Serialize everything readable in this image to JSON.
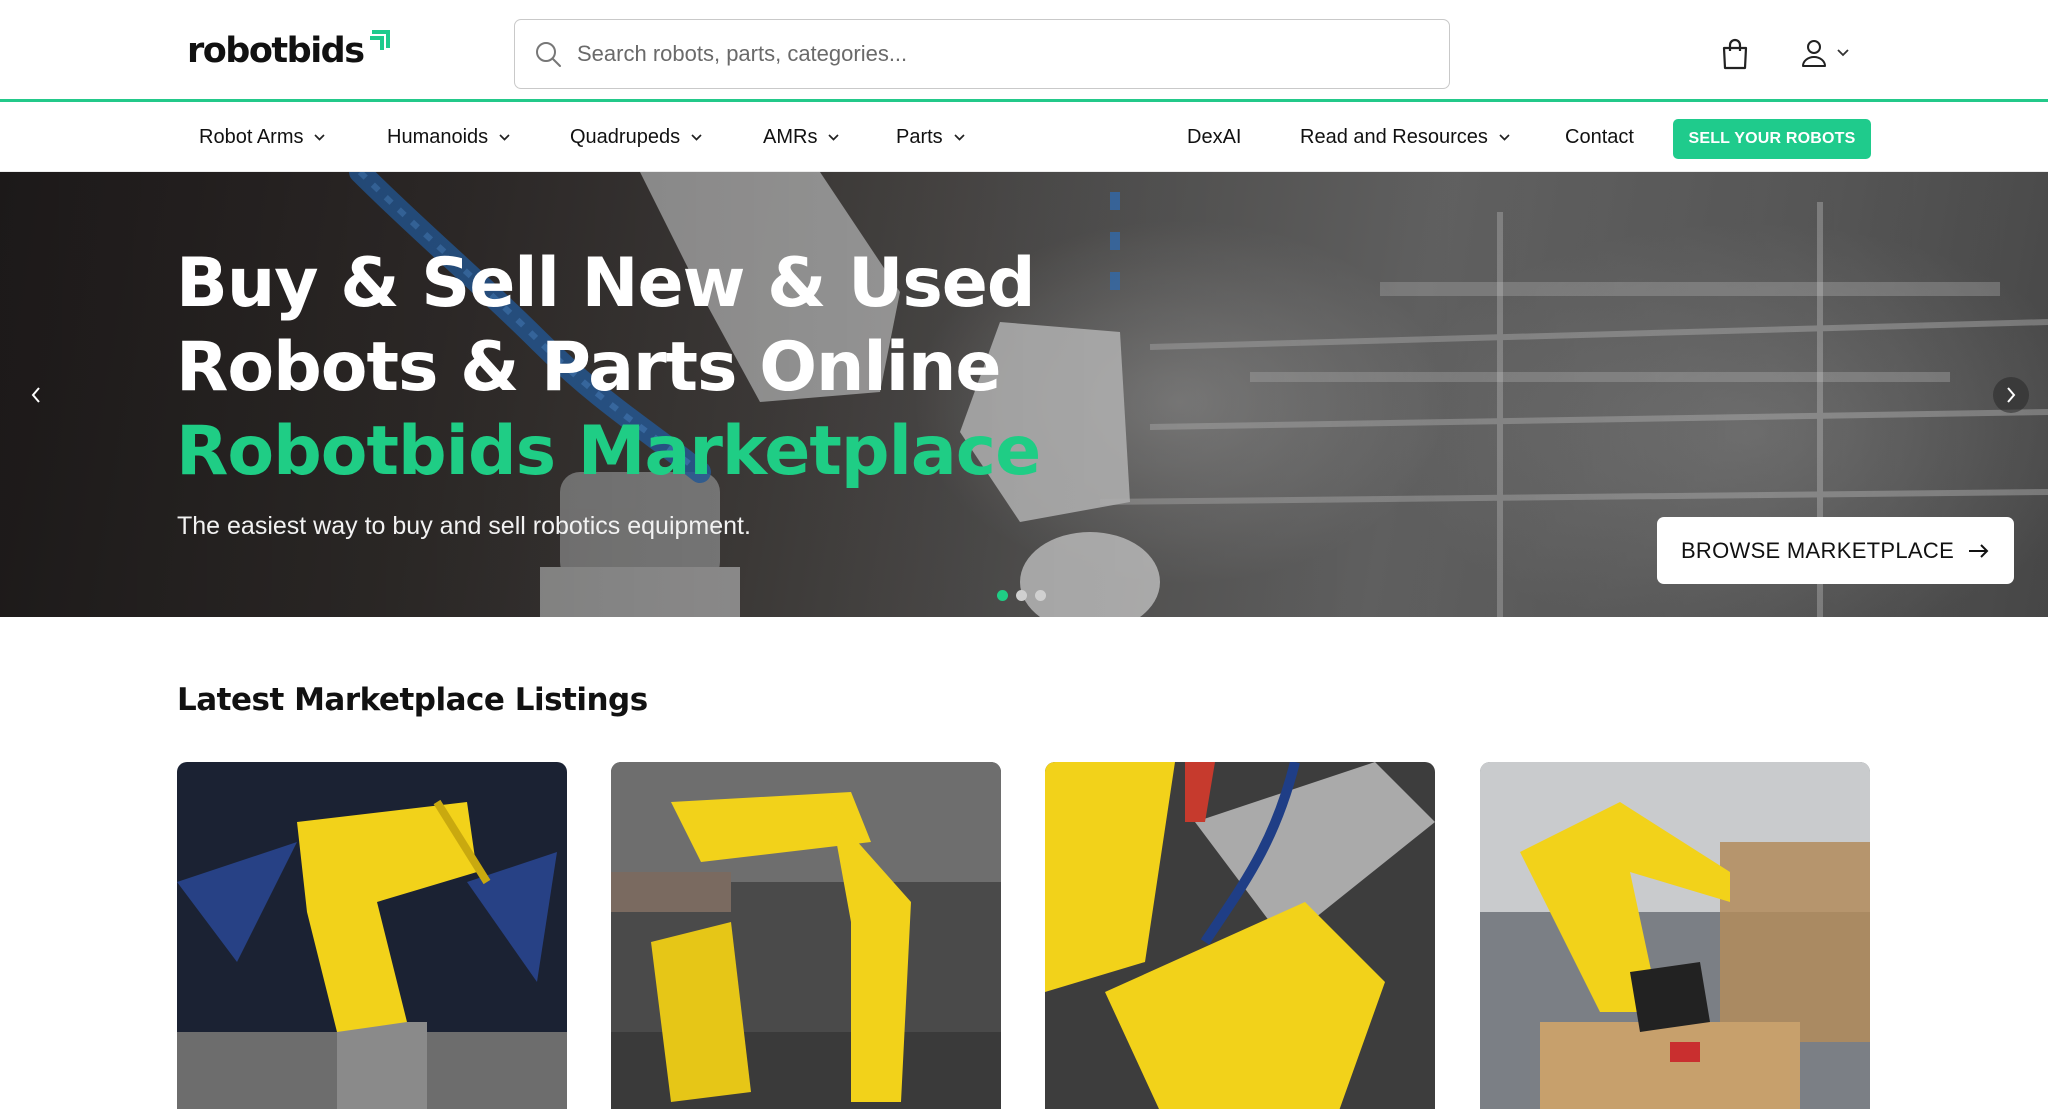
{
  "header": {
    "logo_text": "robotbids",
    "search": {
      "placeholder": "Search robots, parts, categories..."
    },
    "icons": {
      "search": "search-icon",
      "cart": "shopping-bag-icon",
      "account": "user-icon"
    }
  },
  "nav": {
    "items": [
      {
        "label": "Robot Arms",
        "has_dropdown": true
      },
      {
        "label": "Humanoids",
        "has_dropdown": true
      },
      {
        "label": "Quadrupeds",
        "has_dropdown": true
      },
      {
        "label": "AMRs",
        "has_dropdown": true
      },
      {
        "label": "Parts",
        "has_dropdown": true
      },
      {
        "label": "DexAI",
        "has_dropdown": false
      },
      {
        "label": "Read and Resources",
        "has_dropdown": true
      },
      {
        "label": "Contact",
        "has_dropdown": false
      }
    ],
    "cta_label": "SELL YOUR ROBOTS"
  },
  "hero": {
    "title_line1": "Buy & Sell New & Used",
    "title_line2": "Robots & Parts Online",
    "title_accent": "Robotbids Marketplace",
    "subtitle": "The easiest way to buy and sell robotics equipment.",
    "cta_label": "BROWSE MARKETPLACE",
    "slides_total": 3,
    "active_slide": 1
  },
  "listings": {
    "title": "Latest Marketplace Listings",
    "cards": [
      {
        "image": "yellow robot arm on display stand"
      },
      {
        "image": "yellow industrial robots in workshop"
      },
      {
        "image": "yellow robot arm close-up"
      },
      {
        "image": "yellow robot arm on wooden crate"
      }
    ]
  },
  "colors": {
    "brand_green": "#1fcb8c",
    "accent_green_text": "#1fcd85",
    "robot_yellow": "#f2d21a"
  }
}
